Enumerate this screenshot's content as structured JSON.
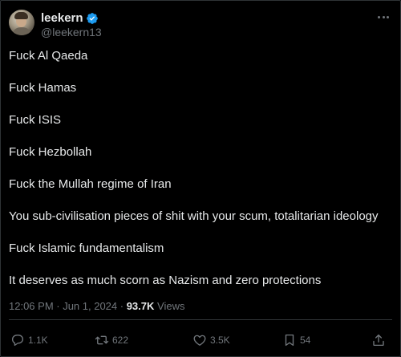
{
  "author": {
    "display_name": "leekern",
    "handle": "@leekern13",
    "verified_icon": "verified-badge-icon",
    "verified_color": "#1d9bf0"
  },
  "post": {
    "lines": [
      "Fuck Al Qaeda",
      "Fuck Hamas",
      "Fuck ISIS",
      "Fuck Hezbollah",
      "Fuck the Mullah regime of Iran",
      "You sub-civilisation pieces of shit with your scum, totalitarian ideology",
      "Fuck Islamic fundamentalism",
      "It deserves as much scorn as Nazism and zero protections"
    ],
    "timestamp": "12:06 PM · Jun 1, 2024 · ",
    "views_count": "93.7K",
    "views_label": " Views"
  },
  "actions": {
    "reply_count": "1.1K",
    "retweet_count": "622",
    "like_count": "3.5K",
    "bookmark_count": "54"
  },
  "colors": {
    "background": "#000000",
    "text": "#e7e9ea",
    "muted": "#71767b",
    "border": "#2f3336"
  }
}
